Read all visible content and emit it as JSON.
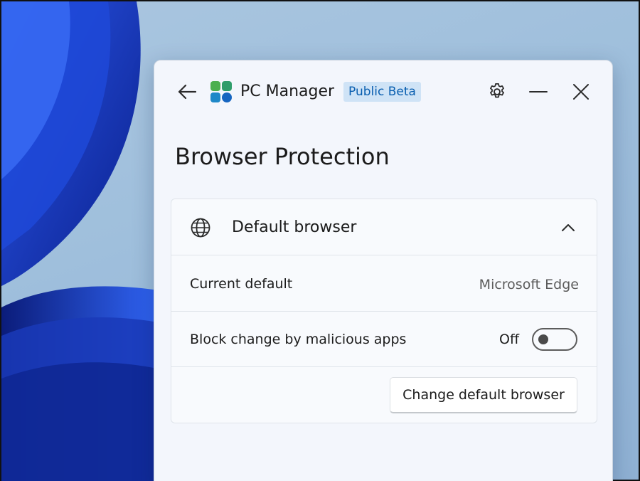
{
  "window": {
    "app_title": "PC Manager",
    "badge": "Public Beta"
  },
  "icons": {
    "back": "back-arrow-icon",
    "logo": "pc-manager-logo-icon",
    "settings": "gear-icon",
    "minimize": "minimize-icon",
    "close": "close-icon",
    "globe": "globe-icon",
    "collapse": "chevron-up-icon"
  },
  "page": {
    "title": "Browser Protection"
  },
  "card": {
    "title": "Default browser",
    "current_default_label": "Current default",
    "current_default_value": "Microsoft Edge",
    "block_label": "Block change by malicious apps",
    "block_state": "Off",
    "block_on": false,
    "change_button": "Change default browser"
  },
  "colors": {
    "badge_bg": "#cfe3f6",
    "badge_text": "#0a5fb0",
    "window_bg": "#f3f6fc",
    "wallpaper_blue": "#1a3fc4"
  }
}
